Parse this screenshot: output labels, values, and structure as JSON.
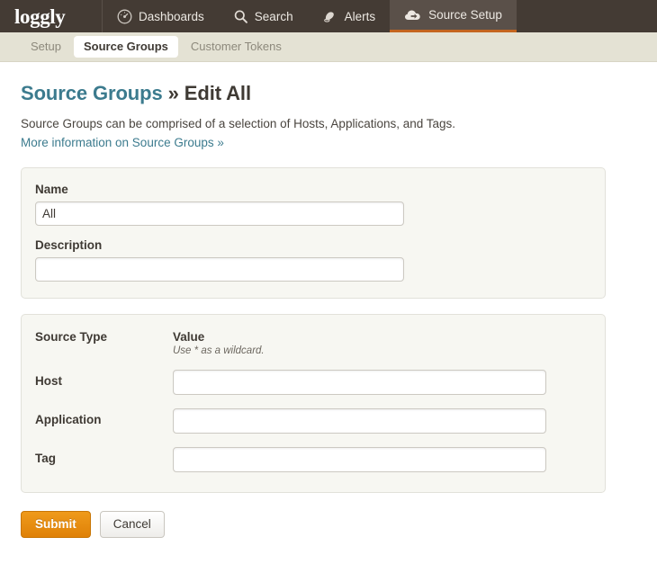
{
  "topnav": {
    "brand": "loggly",
    "items": [
      {
        "label": "Dashboards",
        "icon": "gauge-icon",
        "active": false
      },
      {
        "label": "Search",
        "icon": "search-icon",
        "active": false
      },
      {
        "label": "Alerts",
        "icon": "bell-icon",
        "active": false
      },
      {
        "label": "Source Setup",
        "icon": "cloud-upload-icon",
        "active": true
      }
    ],
    "accent_color": "#c4651f",
    "background_color": "#443b34"
  },
  "subnav": {
    "items": [
      {
        "label": "Setup",
        "active": false
      },
      {
        "label": "Source Groups",
        "active": true
      },
      {
        "label": "Customer Tokens",
        "active": false
      }
    ],
    "background_color": "#e4e2d4"
  },
  "page": {
    "title_link": "Source Groups",
    "title_separator": " » ",
    "title_current": "Edit All",
    "description": "Source Groups can be comprised of a selection of Hosts, Applications, and Tags.",
    "more_info_link": "More information on Source Groups »",
    "link_color": "#3c7b8e"
  },
  "details_panel": {
    "name_label": "Name",
    "name_value": "All",
    "name_placeholder": "",
    "description_label": "Description",
    "description_value": "",
    "description_placeholder": ""
  },
  "sources_panel": {
    "source_type_header": "Source Type",
    "value_header": "Value",
    "value_hint": "Use * as a wildcard.",
    "rows": [
      {
        "type": "Host",
        "value": "",
        "placeholder": ""
      },
      {
        "type": "Application",
        "value": "",
        "placeholder": ""
      },
      {
        "type": "Tag",
        "value": "",
        "placeholder": ""
      }
    ]
  },
  "actions": {
    "submit_label": "Submit",
    "cancel_label": "Cancel",
    "submit_color": "#df8107"
  }
}
